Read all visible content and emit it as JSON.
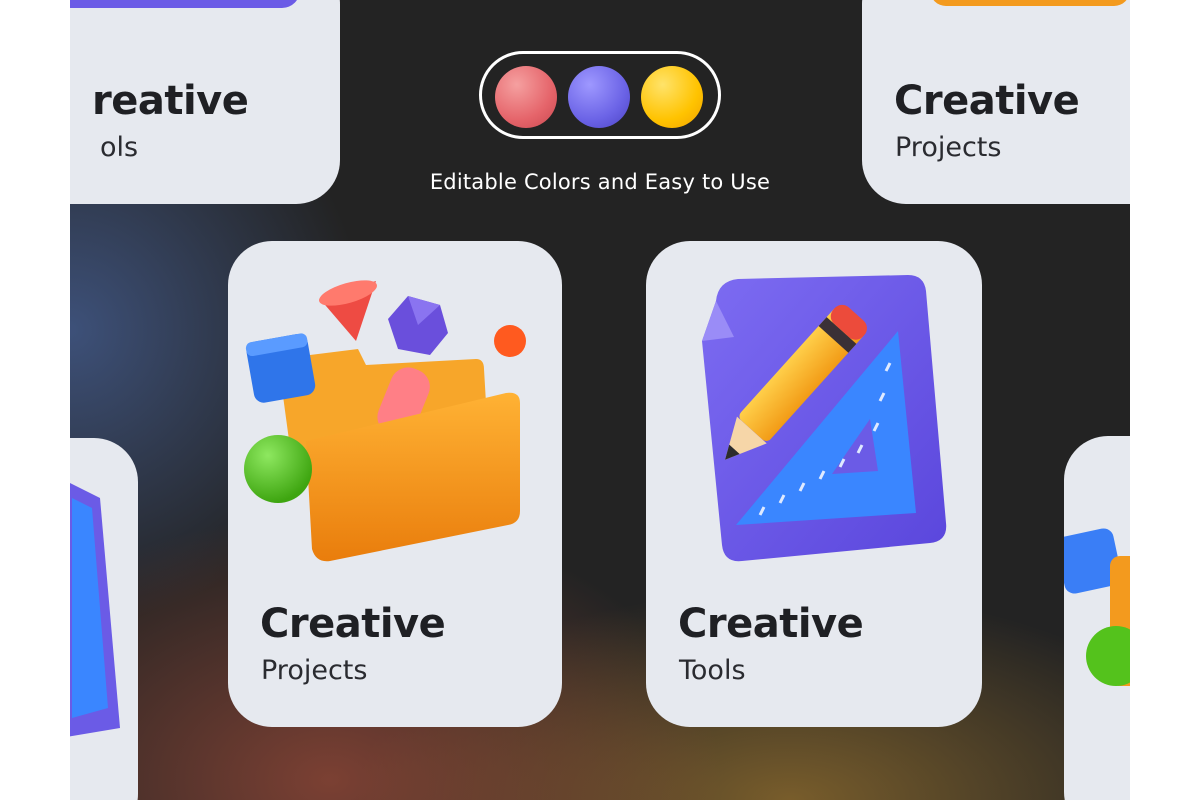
{
  "header": {
    "color_swatches": [
      {
        "name": "red-swatch",
        "color": "#e5646a"
      },
      {
        "name": "purple-swatch",
        "color": "#6b63e6"
      },
      {
        "name": "yellow-swatch",
        "color": "#ffc300"
      }
    ],
    "caption": "Editable Colors and Easy to Use"
  },
  "cards": {
    "top_left": {
      "title": "reative",
      "subtitle": "ols"
    },
    "top_right": {
      "title": "Creative",
      "subtitle": "Projects"
    },
    "projects": {
      "title": "Creative",
      "subtitle": "Projects",
      "icon": "folder-icon"
    },
    "tools": {
      "title": "Creative",
      "subtitle": "Tools",
      "icon": "pencil-ruler-icon"
    }
  },
  "colors": {
    "background": "#232323",
    "card": "#e6e9ef",
    "folder": "#f39a1e",
    "purple": "#6b5be6",
    "blue": "#3a86ff",
    "green": "#54c21c"
  }
}
